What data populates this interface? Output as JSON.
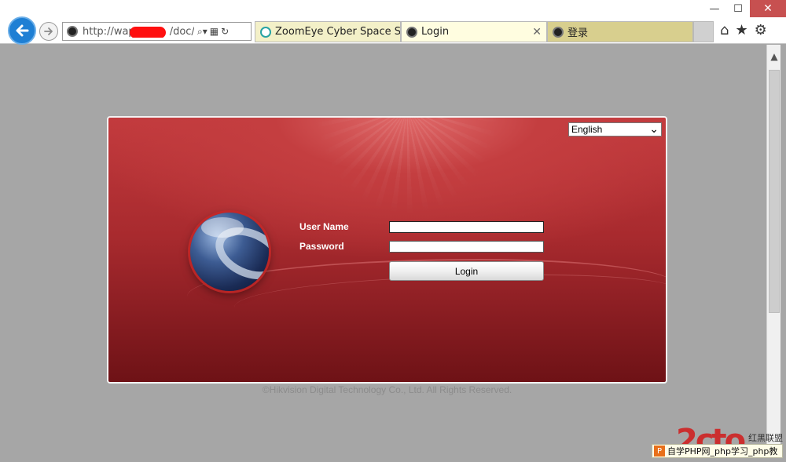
{
  "browser": {
    "window_controls": {
      "minimize": "—",
      "maximize": "☐",
      "close": "✕"
    },
    "address": {
      "text_prefix": "http://wap",
      "text_suffix": "/doc/pa",
      "search_glyph": "⌕▾",
      "compat_glyph": "▦",
      "refresh_glyph": "↻"
    },
    "tabs": [
      {
        "label": "ZoomEye Cyber Space Se...",
        "icon": "zoomeye-favicon"
      },
      {
        "label": "Login",
        "icon": "camera-favicon",
        "close": "✕",
        "active": true
      },
      {
        "label": "登录",
        "icon": "camera-favicon"
      }
    ],
    "tools": {
      "home": "⌂",
      "favorites": "★",
      "settings": "⚙"
    },
    "scroll_up": "▲"
  },
  "login": {
    "language_selected": "English",
    "language_arrow": "⌄",
    "username_label": "User Name",
    "password_label": "Password",
    "login_button": "Login",
    "copyright": "©Hikvision Digital Technology Co., Ltd. All Rights Reserved."
  },
  "watermark": {
    "logo_text": "2cto",
    "cn_text": "红黑联盟",
    "bar_icon": "P",
    "bar_text": "自学PHP网_php学习_php教"
  },
  "colors": {
    "panel_red": "#a82a2e",
    "back_blue": "#1e7fd4",
    "page_gray": "#a6a6a6"
  }
}
